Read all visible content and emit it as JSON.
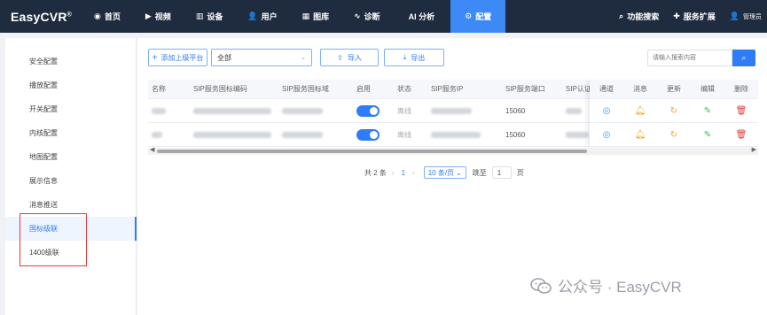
{
  "app": {
    "name": "EasyCVR",
    "mark": "®"
  },
  "nav": {
    "items": [
      {
        "label": "首页",
        "icon": "dashboard-icon",
        "glyph": "◉",
        "active": false
      },
      {
        "label": "视频",
        "icon": "play-icon",
        "glyph": "▶",
        "active": false
      },
      {
        "label": "设备",
        "icon": "bars-icon",
        "glyph": "▥",
        "active": false
      },
      {
        "label": "用户",
        "icon": "user-icon",
        "glyph": "👤",
        "active": false
      },
      {
        "label": "图库",
        "icon": "gallery-icon",
        "glyph": "▦",
        "active": false
      },
      {
        "label": "诊断",
        "icon": "pulse-icon",
        "glyph": "∿",
        "active": false
      },
      {
        "label": "AI 分析",
        "icon": "",
        "glyph": "",
        "active": false
      },
      {
        "label": "配置",
        "icon": "gear-icon",
        "glyph": "⚙",
        "active": true
      }
    ],
    "right": [
      {
        "label": "功能搜索",
        "icon": "search-icon",
        "glyph": "⌕"
      },
      {
        "label": "服务扩展",
        "icon": "puzzle-icon",
        "glyph": "✚"
      },
      {
        "label": "管理员",
        "icon": "user-icon",
        "glyph": "👤"
      }
    ]
  },
  "sidebar": {
    "items": [
      {
        "label": "安全配置",
        "active": false
      },
      {
        "label": "播放配置",
        "active": false
      },
      {
        "label": "开关配置",
        "active": false
      },
      {
        "label": "内核配置",
        "active": false
      },
      {
        "label": "地图配置",
        "active": false
      },
      {
        "label": "展示信息",
        "active": false
      },
      {
        "label": "消息推送",
        "active": false
      },
      {
        "label": "国标级联",
        "active": true
      },
      {
        "label": "1400级联",
        "active": false
      }
    ]
  },
  "toolbar": {
    "add_label": "添加上级平台",
    "select_value": "全部",
    "import_label": "导入",
    "export_label": "导出"
  },
  "search": {
    "placeholder": "请输入搜索内容"
  },
  "table": {
    "headers": {
      "name": "名称",
      "code": "SIP服务国标编码",
      "domain": "SIP服务国标域",
      "enable": "启用",
      "status": "状态",
      "ip": "SIP服务IP",
      "port": "SIP服务端口",
      "auth": "SIP认证用",
      "channel": "通道",
      "message": "消息",
      "update": "更新",
      "edit": "编辑",
      "delete": "删除"
    },
    "rows": [
      {
        "status": "离线",
        "port": "15060",
        "enabled": true
      },
      {
        "status": "离线",
        "port": "15060",
        "enabled": true
      }
    ]
  },
  "pager": {
    "total": "共 2 条",
    "current_page": "1",
    "page_size": "10 条/页",
    "goto_label": "跳至",
    "goto_value": "1",
    "page_unit": "页"
  },
  "watermark": {
    "text": "公众号 · EasyCVR"
  },
  "colors": {
    "accent": "#2f7cf6",
    "topbar": "#1f2b3e",
    "highlight_box": "#e53935"
  }
}
